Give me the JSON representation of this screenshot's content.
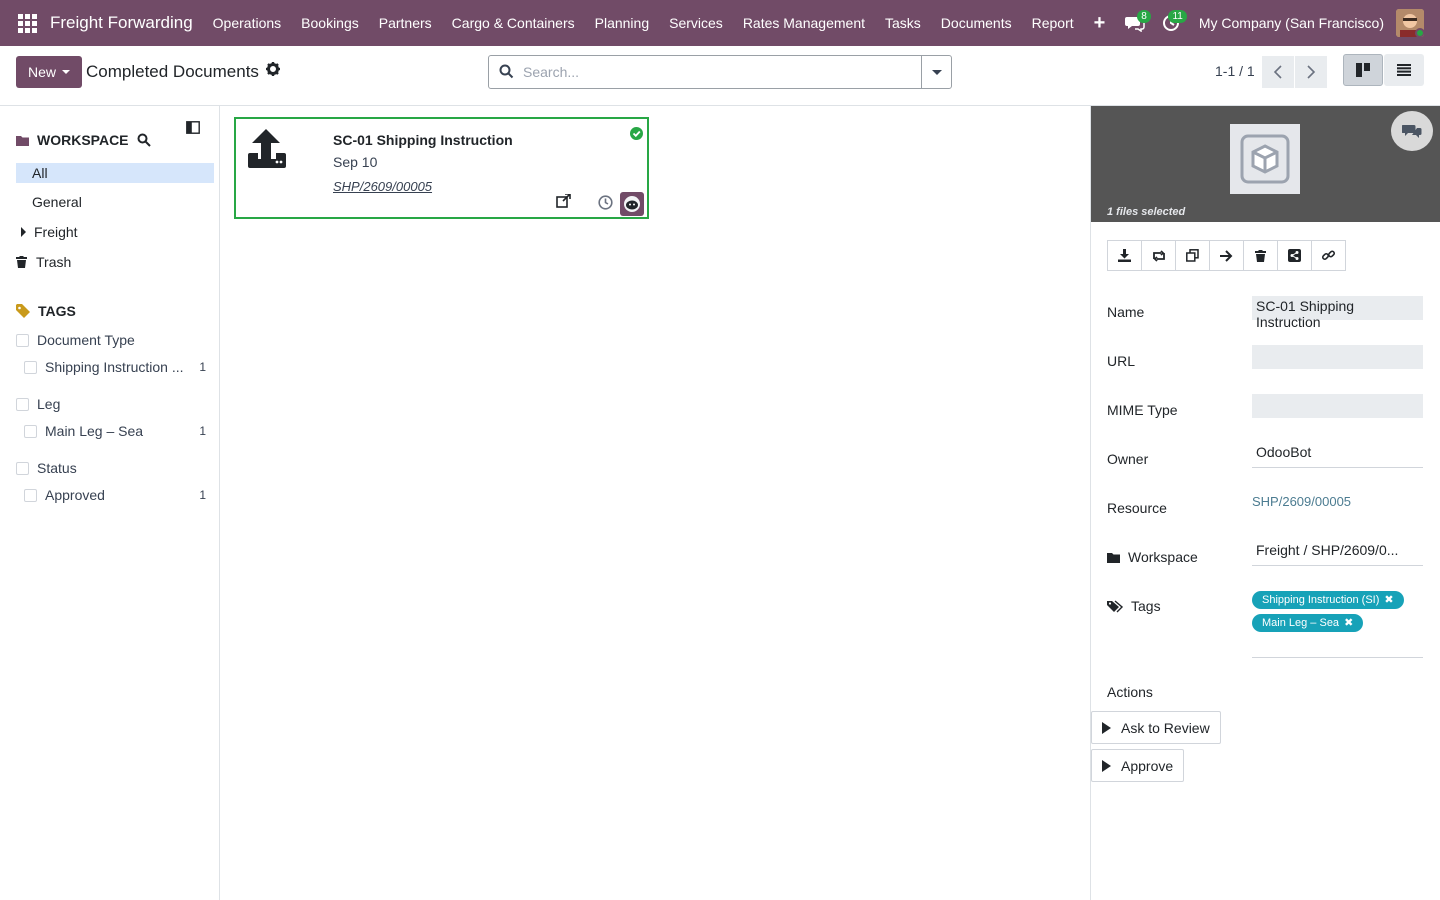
{
  "navbar": {
    "brand": "Freight Forwarding",
    "menu": [
      "Operations",
      "Bookings",
      "Partners",
      "Cargo & Containers",
      "Planning",
      "Services",
      "Rates Management",
      "Tasks",
      "Documents",
      "Report"
    ],
    "add_symbol": "+",
    "messages_count": "8",
    "activities_count": "11",
    "company": "My Company (San Francisco)"
  },
  "control": {
    "new_label": "New",
    "page_title": "Completed Documents",
    "search_placeholder": "Search...",
    "pager": "1-1 / 1"
  },
  "sidebar": {
    "workspace_title": "WORKSPACE",
    "workspaces": [
      "All",
      "General",
      "Freight",
      "Trash"
    ],
    "tags_title": "TAGS",
    "tag_groups": [
      {
        "name": "Document Type",
        "tags": [
          {
            "name": "Shipping Instruction ...",
            "count": "1"
          }
        ]
      },
      {
        "name": "Leg",
        "tags": [
          {
            "name": "Main Leg – Sea",
            "count": "1"
          }
        ]
      },
      {
        "name": "Status",
        "tags": [
          {
            "name": "Approved",
            "count": "1"
          }
        ]
      }
    ]
  },
  "card": {
    "title": "SC-01 Shipping Instruction",
    "date": "Sep 10",
    "reference": "SHP/2609/00005",
    "status_color": "#28a745"
  },
  "panel": {
    "files_selected": "1 files selected",
    "fields": {
      "name_label": "Name",
      "name_value": "SC-01 Shipping Instruction",
      "url_label": "URL",
      "url_value": "",
      "mime_label": "MIME Type",
      "mime_value": "",
      "owner_label": "Owner",
      "owner_value": "OdooBot",
      "resource_label": "Resource",
      "resource_value": "SHP/2609/00005",
      "workspace_label": "Workspace",
      "workspace_value": "Freight / SHP/2609/0...",
      "tags_label": "Tags",
      "tags": [
        "Shipping Instruction (SI)",
        "Main Leg – Sea"
      ]
    },
    "actions_title": "Actions",
    "actions": [
      "Ask to Review",
      "Approve"
    ]
  },
  "colors": {
    "navbar": "#714b67",
    "tag_pill": "#17a2b8",
    "success": "#28a745",
    "active_item": "#d6e6fb"
  }
}
